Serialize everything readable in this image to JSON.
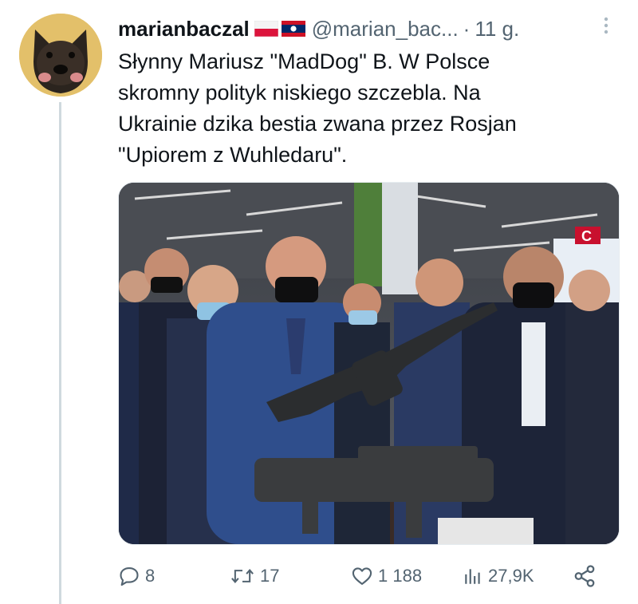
{
  "tweet": {
    "display_name": "marianbaczal",
    "handle": "@marian_bac...",
    "separator": "·",
    "time": "11 g.",
    "text_lines": [
      "Słynny Mariusz \"MadDog\" B. W Polsce",
      "skromny polityk niskiego szczebla. Na",
      "Ukrainie dzika bestia zwana przez Rosjan",
      "\"Upiorem z Wuhledaru\"."
    ],
    "media_sign_text": "C"
  },
  "actions": {
    "replies": "8",
    "retweets": "17",
    "likes": "1 188",
    "views": "27,9K"
  },
  "colors": {
    "text_primary": "#0f1419",
    "text_secondary": "#536471",
    "thread_line": "#cfd9de"
  },
  "icons": [
    "poland-flag-icon",
    "laos-flag-icon",
    "more-options-icon",
    "reply-icon",
    "retweet-icon",
    "like-icon",
    "views-icon",
    "share-icon"
  ]
}
